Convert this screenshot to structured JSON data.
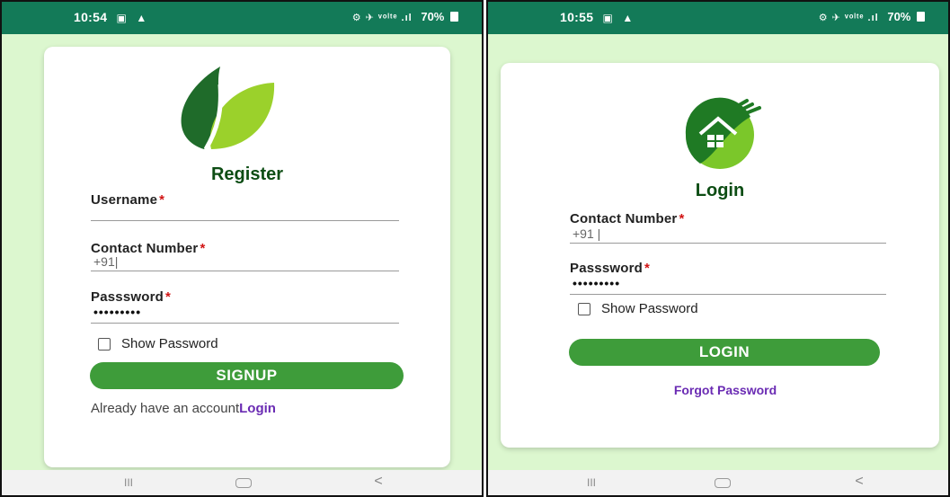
{
  "left_screen": {
    "status_bar": {
      "time": "10:54",
      "right_icons": "⚙ ✈ ᵛᵒˡᵗᵉ .ıl",
      "battery": "70%"
    },
    "title": "Register",
    "username": {
      "label": "Username",
      "required": "*",
      "value": ""
    },
    "contact": {
      "label": "Contact Number",
      "required": "*",
      "value": "+91|"
    },
    "password": {
      "label": "Passsword",
      "required": "*",
      "value": "•••••••••"
    },
    "show_password_label": "Show Password",
    "signup_label": "SIGNUP",
    "footer": {
      "text": "Already have an account",
      "link": "Login"
    },
    "nav": {
      "recents": "III",
      "back": "<"
    }
  },
  "right_screen": {
    "status_bar": {
      "time": "10:55",
      "right_icons": "⚙ ✈ ᵛᵒˡᵗᵉ .ıl",
      "battery": "70%"
    },
    "title": "Login",
    "contact": {
      "label": "Contact Number",
      "required": "*",
      "value": "+91 |"
    },
    "password": {
      "label": "Passsword",
      "required": "*",
      "value": "•••••••••"
    },
    "show_password_label": "Show Password",
    "login_label": "LOGIN",
    "forgot_label": "Forgot Password",
    "nav": {
      "recents": "III",
      "back": "<"
    }
  },
  "colors": {
    "status_green": "#137a58",
    "background": "#dcf7cf",
    "button_green": "#3e9c3a",
    "link_purple": "#6a2bb3",
    "required_red": "#d11313"
  }
}
